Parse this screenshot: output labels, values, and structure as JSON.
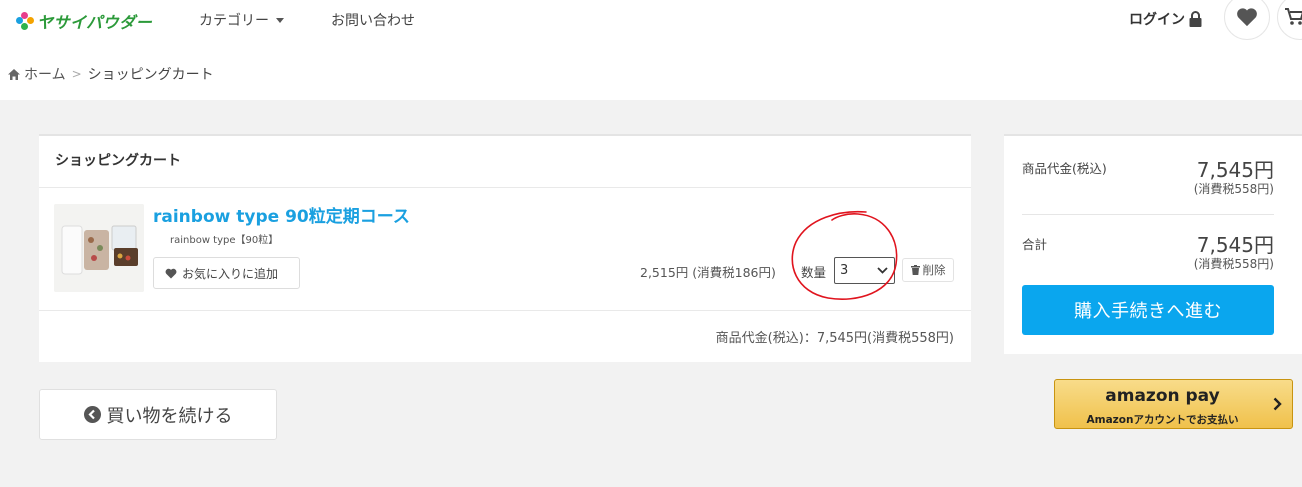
{
  "header": {
    "logo_text": "ヤサイパウダー",
    "nav_category": "カテゴリー",
    "nav_contact": "お問い合わせ",
    "login_label": "ログイン"
  },
  "breadcrumb": {
    "home": "ホーム",
    "separator": ">",
    "current": "ショッピングカート"
  },
  "cart": {
    "heading": "ショッピングカート",
    "item": {
      "title": "rainbow type 90粒定期コース",
      "variant": "rainbow type【90粒】",
      "favorite_label": "お気に入りに追加",
      "unit_price": "2,515円 (消費税186円)",
      "quantity_label": "数量",
      "quantity_value": "3",
      "delete_label": "削除"
    },
    "subtotal": "商品代金(税込)：7,545円(消費税558円)"
  },
  "summary": {
    "items_label": "商品代金(税込)",
    "items_price": "7,545円",
    "items_tax": "(消費税558円)",
    "total_label": "合計",
    "total_price": "7,545円",
    "total_tax": "(消費税558円)",
    "checkout_label": "購入手続きへ進む"
  },
  "continue_label": "買い物を続ける",
  "amazon_pay": {
    "logo": "amazon pay",
    "sub": "Amazonアカウントでお支払い"
  },
  "colors": {
    "accent_blue": "#0aa6ee",
    "title_blue": "#1aa0e0",
    "annotation_red": "#e0141e",
    "background_gray": "#f2f2f2",
    "amazon_yellow": "#f0c14b"
  },
  "icons": [
    "flower-logo-icon",
    "caret-down-icon",
    "lock-icon",
    "heart-icon",
    "cart-icon",
    "home-icon",
    "chevron-down-icon",
    "trash-icon",
    "circle-chevron-left-icon",
    "chevron-right-icon"
  ]
}
